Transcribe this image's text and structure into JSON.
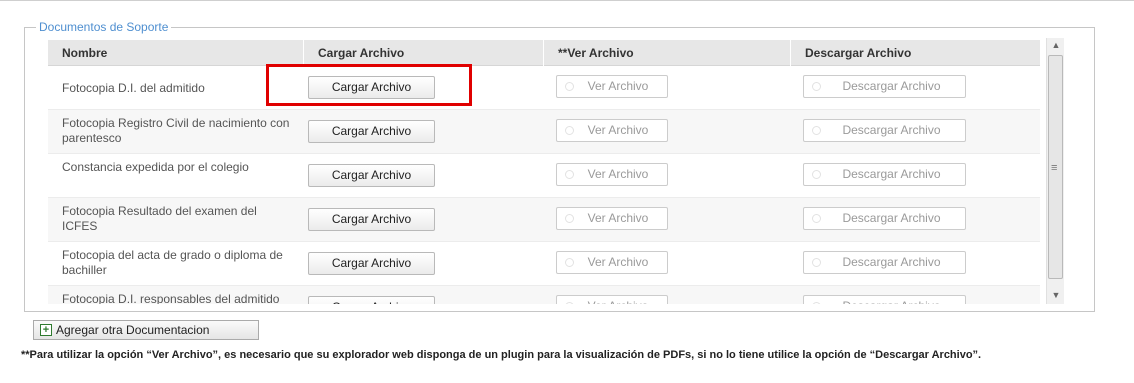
{
  "section": {
    "legend": "Documentos de Soporte"
  },
  "table": {
    "headers": [
      "Nombre",
      "Cargar Archivo",
      "**Ver Archivo",
      "Descargar Archivo"
    ],
    "rows": [
      {
        "name": "Fotocopia D.I. del admitido",
        "upload": "Cargar Archivo",
        "view": "Ver Archivo",
        "download": "Descargar Archivo"
      },
      {
        "name": "Fotocopia Registro Civil de nacimiento con parentesco",
        "upload": "Cargar Archivo",
        "view": "Ver Archivo",
        "download": "Descargar Archivo"
      },
      {
        "name": "Constancia expedida por el colegio",
        "upload": "Cargar Archivo",
        "view": "Ver Archivo",
        "download": "Descargar Archivo"
      },
      {
        "name": "Fotocopia Resultado del examen del ICFES",
        "upload": "Cargar Archivo",
        "view": "Ver Archivo",
        "download": "Descargar Archivo"
      },
      {
        "name": "Fotocopia del acta de grado o diploma de bachiller",
        "upload": "Cargar Archivo",
        "view": "Ver Archivo",
        "download": "Descargar Archivo"
      },
      {
        "name": "Fotocopia D.I. responsables del admitido",
        "upload": "Cargar Archivo",
        "view": "Ver Archivo",
        "download": "Descargar Archivo"
      }
    ]
  },
  "add_button": {
    "label": "Agregar otra Documentacion",
    "icon": "plus-icon"
  },
  "note": "**Para utilizar la opción “Ver Archivo”, es necesario que su explorador web disponga de un plugin para la visualización de PDFs, si no lo tiene utilice la opción de “Descargar Archivo”.",
  "colors": {
    "legend": "#4f8fd0",
    "highlight": "#e00000",
    "add_icon": "#2e7a2e"
  }
}
